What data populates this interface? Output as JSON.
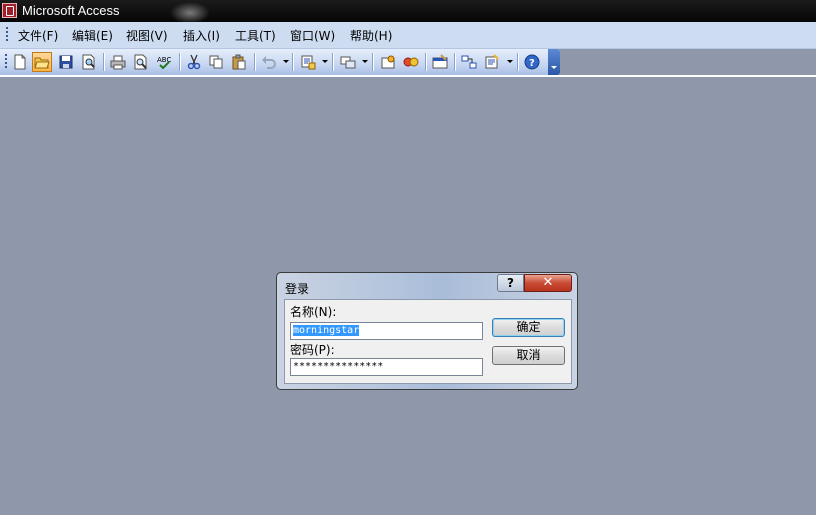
{
  "window": {
    "title": "Microsoft Access"
  },
  "menu": {
    "items": [
      {
        "label": "文件(F)"
      },
      {
        "label": "编辑(E)"
      },
      {
        "label": "视图(V)"
      },
      {
        "label": "插入(I)"
      },
      {
        "label": "工具(T)"
      },
      {
        "label": "窗口(W)"
      },
      {
        "label": "帮助(H)"
      }
    ]
  },
  "toolbar": {
    "icons": [
      "new-file-icon",
      "open-folder-icon",
      "save-icon",
      "file-search-icon",
      "print-icon",
      "print-preview-icon",
      "spelling-icon",
      "cut-icon",
      "copy-icon",
      "paste-icon",
      "undo-icon",
      "office-links-icon",
      "analyze-icon",
      "code-icon",
      "script-icon",
      "properties-icon",
      "relationships-icon",
      "new-object-icon",
      "help-icon"
    ],
    "active": "open-folder-icon"
  },
  "dialog": {
    "title": "登录",
    "help_label": "?",
    "close_label": "✕",
    "name_label": "名称(N):",
    "name_value": "morningstar",
    "password_label": "密码(P):",
    "password_value": "***************",
    "ok_label": "确定",
    "cancel_label": "取消"
  },
  "colors": {
    "workspace": "#8f97ab",
    "menubar": "#cedcf2",
    "selection": "#3399ff",
    "close_button": "#c94b34"
  }
}
